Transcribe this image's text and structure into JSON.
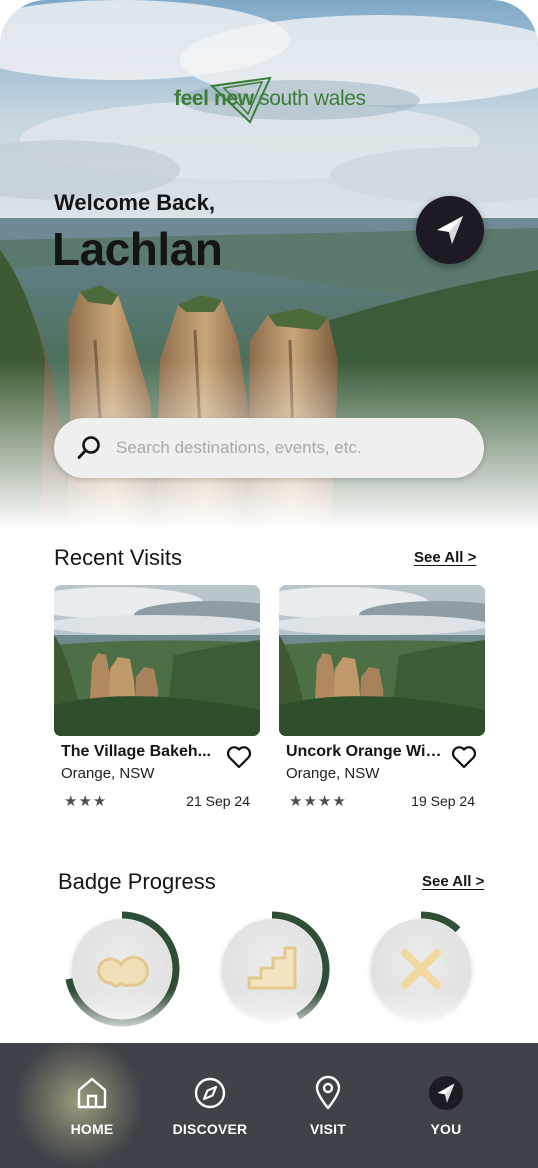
{
  "brand": {
    "part1": "feel new",
    "part2": " south wales"
  },
  "greeting": {
    "welcome": "Welcome Back,",
    "name": "Lachlan"
  },
  "search": {
    "placeholder": "Search destinations, events, etc."
  },
  "recent_visits": {
    "title": "Recent Visits",
    "see_all": "See All >",
    "items": [
      {
        "name": "The Village Bakeh...",
        "location": "Orange, NSW",
        "stars": "★★★",
        "rating": 3,
        "date": "21 Sep 24"
      },
      {
        "name": "Uncork Orange Wine...",
        "location": "Orange, NSW",
        "stars": "★★★★",
        "rating": 4,
        "date": "19 Sep 24"
      }
    ]
  },
  "badge_progress": {
    "title": "Badge Progress",
    "see_all": "See All >",
    "badges": [
      {
        "icon": "speech-bubble-icon",
        "progress": 0.72
      },
      {
        "icon": "stairs-icon",
        "progress": 0.42
      },
      {
        "icon": "x-cross-icon",
        "progress": 0.12
      }
    ],
    "ring_color": "#2f4f36"
  },
  "tabs": [
    {
      "label": "HOME",
      "icon": "house-icon",
      "active": true
    },
    {
      "label": "DISCOVER",
      "icon": "compass-icon",
      "active": false
    },
    {
      "label": "VISIT",
      "icon": "map-pin-icon",
      "active": false
    },
    {
      "label": "YOU",
      "icon": "navigation-arrow-icon",
      "active": false
    }
  ],
  "colors": {
    "tab_bar": "#3f4349",
    "accent_green": "#3a7d36",
    "fab": "#1e1a24"
  }
}
